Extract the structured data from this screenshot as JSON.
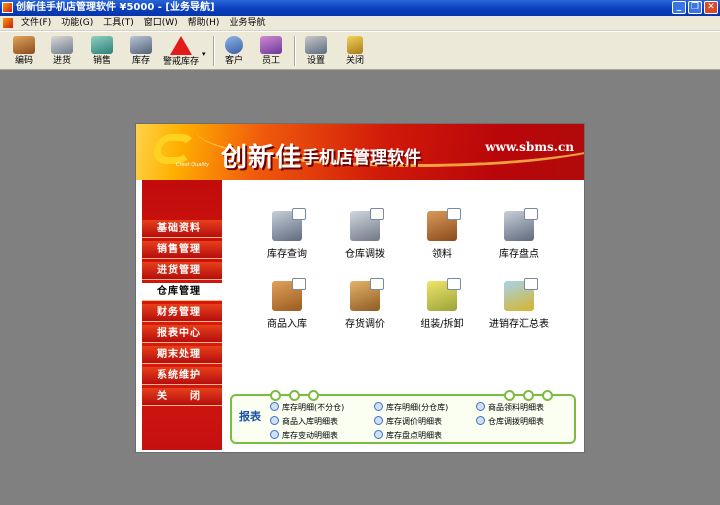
{
  "window": {
    "title": "创新佳手机店管理软件 ¥5000 - [业务导航]",
    "controls": [
      "_",
      "❐",
      "✕"
    ]
  },
  "menu": [
    "文件(F)",
    "功能(G)",
    "工具(T)",
    "窗口(W)",
    "帮助(H)",
    "业务导航"
  ],
  "toolbar": [
    {
      "label": "编码",
      "icon": "box-icon"
    },
    {
      "label": "进货",
      "icon": "truck-icon"
    },
    {
      "label": "销售",
      "icon": "cart-icon"
    },
    {
      "label": "库存",
      "icon": "warehouse-icon"
    },
    {
      "label": "警戒库存",
      "icon": "warning-icon"
    },
    {
      "label": "客户",
      "icon": "person-icon"
    },
    {
      "label": "员工",
      "icon": "people-icon"
    },
    {
      "label": "设置",
      "icon": "tools-icon"
    },
    {
      "label": "关闭",
      "icon": "exit-door-icon"
    }
  ],
  "banner": {
    "brand": "创新佳",
    "subtitle": "手机店管理软件",
    "url": "www.sbms.cn",
    "logo_sub": "Creat Quality"
  },
  "sidebar": [
    {
      "label": "基础资料"
    },
    {
      "label": "销售管理"
    },
    {
      "label": "进货管理"
    },
    {
      "label": "仓库管理",
      "active": true
    },
    {
      "label": "财务管理"
    },
    {
      "label": "报表中心"
    },
    {
      "label": "期末处理"
    },
    {
      "label": "系统维护"
    },
    {
      "label": "关　　闭"
    }
  ],
  "modules": [
    {
      "label": "库存查询"
    },
    {
      "label": "仓库调拨"
    },
    {
      "label": "领料"
    },
    {
      "label": "库存盘点"
    },
    {
      "label": "商品入库"
    },
    {
      "label": "存货调价"
    },
    {
      "label": "组装/拆卸"
    },
    {
      "label": "进销存汇总表"
    }
  ],
  "reports": {
    "title": "报表",
    "links": [
      "库存明细(不分仓)",
      "库存明细(分仓库)",
      "商品领料明细表",
      "商品入库明细表",
      "库存调价明细表",
      "仓库调拨明细表",
      "库存变动明细表",
      "库存盘点明细表"
    ]
  }
}
